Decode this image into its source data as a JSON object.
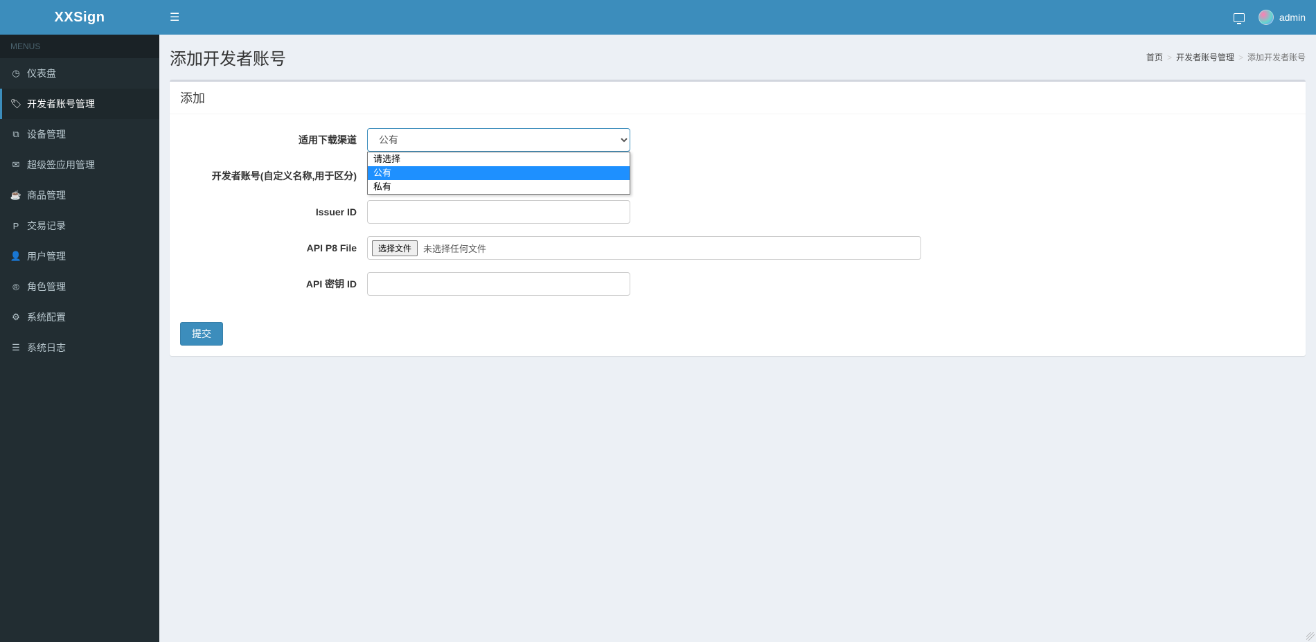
{
  "brand": "XXSign",
  "topbar": {
    "username": "admin"
  },
  "sidebar": {
    "header": "MENUS",
    "items": [
      {
        "icon": "dashboard",
        "label": "仪表盘"
      },
      {
        "icon": "tags",
        "label": "开发者账号管理",
        "active": true
      },
      {
        "icon": "copy",
        "label": "设备管理"
      },
      {
        "icon": "comments",
        "label": "超级签应用管理"
      },
      {
        "icon": "coffee",
        "label": "商品管理"
      },
      {
        "icon": "paypal",
        "label": "交易记录"
      },
      {
        "icon": "user",
        "label": "用户管理"
      },
      {
        "icon": "registered",
        "label": "角色管理"
      },
      {
        "icon": "cog",
        "label": "系统配置"
      },
      {
        "icon": "list",
        "label": "系统日志"
      }
    ]
  },
  "page": {
    "title": "添加开发者账号",
    "breadcrumb": {
      "home": "首页",
      "parent": "开发者账号管理",
      "current": "添加开发者账号"
    },
    "box_title": "添加"
  },
  "form": {
    "channel_label": "适用下载渠道",
    "channel_selected": "公有",
    "channel_options": [
      "请选择",
      "公有",
      "私有"
    ],
    "channel_highlight_index": 1,
    "dev_account_label": "开发者账号(自定义名称,用于区分)",
    "issuer_id_label": "Issuer ID",
    "api_p8_label": "API P8 File",
    "file_button": "选择文件",
    "file_placeholder": "未选择任何文件",
    "api_key_label": "API 密钥 ID",
    "submit": "提交"
  }
}
